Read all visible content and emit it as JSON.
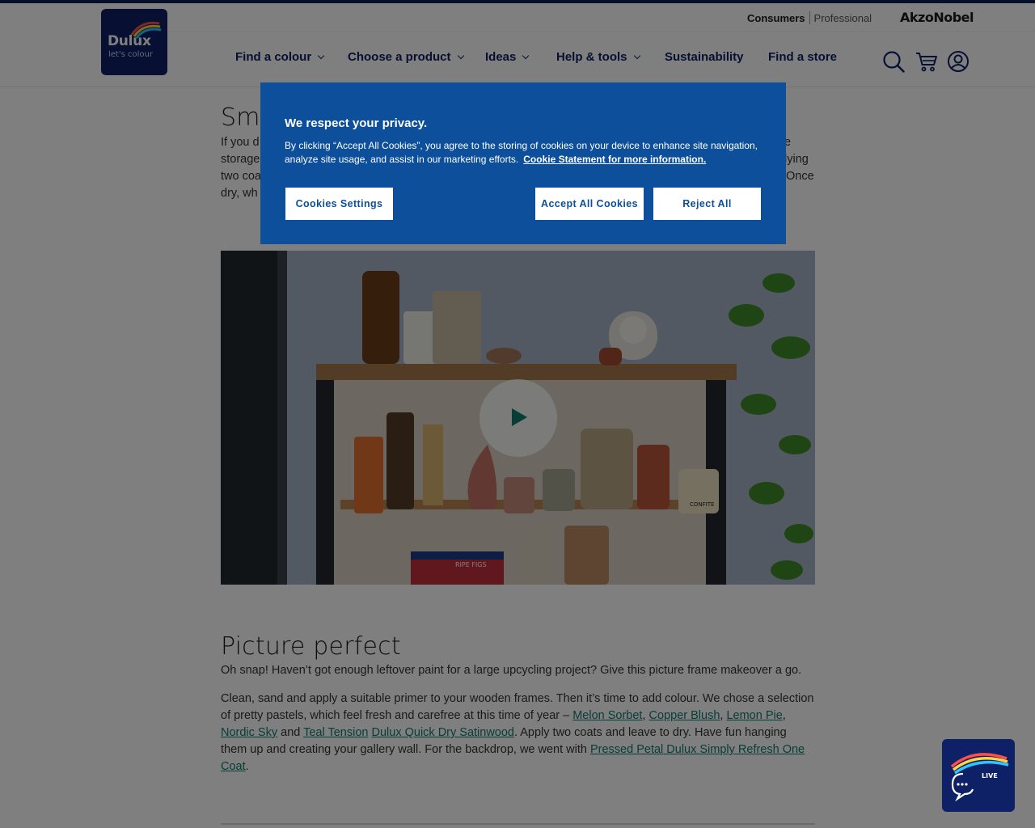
{
  "header": {
    "logo": {
      "brand": "Dulux",
      "tagline": "let's colour"
    },
    "brand_switch": {
      "consumers": "Consumers",
      "professional": "Professional"
    },
    "parent_brand": "AkzoNobel",
    "nav": [
      {
        "label": "Find a colour",
        "has_dropdown": true
      },
      {
        "label": "Choose a product",
        "has_dropdown": true
      },
      {
        "label": "Ideas",
        "has_dropdown": true
      },
      {
        "label": "Help & tools",
        "has_dropdown": true
      },
      {
        "label": "Sustainability",
        "has_dropdown": false
      },
      {
        "label": "Find a store",
        "has_dropdown": false
      }
    ],
    "icons": [
      "search-icon",
      "cart-icon",
      "account-icon"
    ]
  },
  "section1": {
    "heading": "Sm",
    "lines": [
      {
        "left": "If you d",
        "right": "e"
      },
      {
        "left": "storage",
        "right": "lying"
      },
      {
        "left": "two coa",
        "right": "Once"
      },
      {
        "left": "dry, wh",
        "right": ""
      }
    ]
  },
  "video": {
    "play_label": "Play video",
    "jar_label_1": "RIPE FIGS",
    "jar_label_2": "CONFITE"
  },
  "section2": {
    "heading": "Picture perfect",
    "intro": "Oh snap! Haven’t got enough leftover paint for a large upcycling project? Give this picture frame makeover a go.",
    "para_parts": {
      "t1": "Clean, sand and apply a suitable primer to your wooden frames. Then it’s time to add colour. We chose a selection of pretty pastels, which feel fresh and carefree at this time of year – ",
      "l1": "Melon Sorbet",
      "s1": ", ",
      "l2": "Copper Blush",
      "s2": ", ",
      "l3": "Lemon Pie",
      "s3": ", ",
      "l4": "Nordic Sky",
      "s4": " and ",
      "l5": "Teal Tension",
      "s5": " ",
      "l6": "Dulux Quick Dry Satinwood",
      "t2": ". Apply two coats and leave to dry. Have fun hanging them up and creating your gallery wall. For the backdrop, we went with ",
      "l7": "Pressed Petal Dulux Simply Refresh One Coat",
      "t3": "."
    }
  },
  "cookie": {
    "title": "We respect your privacy.",
    "text": "By clicking “Accept All Cookies”, you agree to the storing of cookies on your device to enhance site navigation, analyze site usage, and assist in our marketing efforts.",
    "link": "Cookie Statement for more information.",
    "settings": "Cookies Settings",
    "accept": "Accept All Cookies",
    "reject": "Reject All"
  },
  "chat": {
    "live": "LIVE",
    "word": "Chat"
  },
  "colors": {
    "navy": "#0e2167",
    "cookie_blue": "#0d4f9a",
    "link_teal": "#0e7a6f"
  }
}
